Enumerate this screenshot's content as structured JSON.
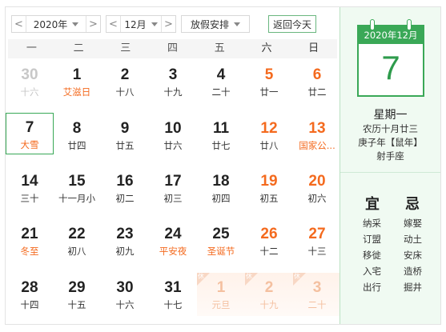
{
  "toolbar": {
    "year_select": "2020年",
    "month_select": "12月",
    "holiday_select": "放假安排",
    "today_button": "返回今天",
    "prev_arrow": "<",
    "next_arrow": ">"
  },
  "weekdays": [
    "一",
    "二",
    "三",
    "四",
    "五",
    "六",
    "日"
  ],
  "days": [
    {
      "n": "30",
      "l": "十六",
      "faded": true
    },
    {
      "n": "1",
      "l": "艾滋日",
      "fest": true
    },
    {
      "n": "2",
      "l": "十八"
    },
    {
      "n": "3",
      "l": "十九"
    },
    {
      "n": "4",
      "l": "二十"
    },
    {
      "n": "5",
      "l": "廿一",
      "wkend": true
    },
    {
      "n": "6",
      "l": "廿二",
      "wkend": true
    },
    {
      "n": "7",
      "l": "大雪",
      "fest": true,
      "sel": true
    },
    {
      "n": "8",
      "l": "廿四"
    },
    {
      "n": "9",
      "l": "廿五"
    },
    {
      "n": "10",
      "l": "廿六"
    },
    {
      "n": "11",
      "l": "廿七"
    },
    {
      "n": "12",
      "l": "廿八",
      "wkend": true
    },
    {
      "n": "13",
      "l": "国家公...",
      "wkend": true,
      "fest": true
    },
    {
      "n": "14",
      "l": "三十"
    },
    {
      "n": "15",
      "l": "十一月小"
    },
    {
      "n": "16",
      "l": "初二"
    },
    {
      "n": "17",
      "l": "初三"
    },
    {
      "n": "18",
      "l": "初四"
    },
    {
      "n": "19",
      "l": "初五",
      "wkend": true
    },
    {
      "n": "20",
      "l": "初六",
      "wkend": true
    },
    {
      "n": "21",
      "l": "冬至",
      "fest": true
    },
    {
      "n": "22",
      "l": "初八"
    },
    {
      "n": "23",
      "l": "初九"
    },
    {
      "n": "24",
      "l": "平安夜",
      "fest": true
    },
    {
      "n": "25",
      "l": "圣诞节",
      "fest": true
    },
    {
      "n": "26",
      "l": "十二",
      "wkend": true
    },
    {
      "n": "27",
      "l": "十三",
      "wkend": true
    },
    {
      "n": "28",
      "l": "十四"
    },
    {
      "n": "29",
      "l": "十五"
    },
    {
      "n": "30",
      "l": "十六"
    },
    {
      "n": "31",
      "l": "十七"
    },
    {
      "n": "1",
      "l": "元旦",
      "hol": true
    },
    {
      "n": "2",
      "l": "十九",
      "hol": true
    },
    {
      "n": "3",
      "l": "二十",
      "hol": true
    }
  ],
  "holiday_badge": "休",
  "side": {
    "header": "2020年12月",
    "day": "7",
    "weekday": "星期一",
    "lunar": "农历十月廿三",
    "ganzhi": "庚子年【鼠年】",
    "zodiac": "射手座",
    "yi_title": "宜",
    "ji_title": "忌",
    "yi": [
      "纳采",
      "订盟",
      "移徙",
      "入宅",
      "出行"
    ],
    "ji": [
      "嫁娶",
      "动土",
      "安床",
      "造桥",
      "掘井"
    ]
  },
  "colors": {
    "accent": "#3aa857",
    "weekend": "#f46a1e",
    "faded": "#c8c8c8"
  }
}
